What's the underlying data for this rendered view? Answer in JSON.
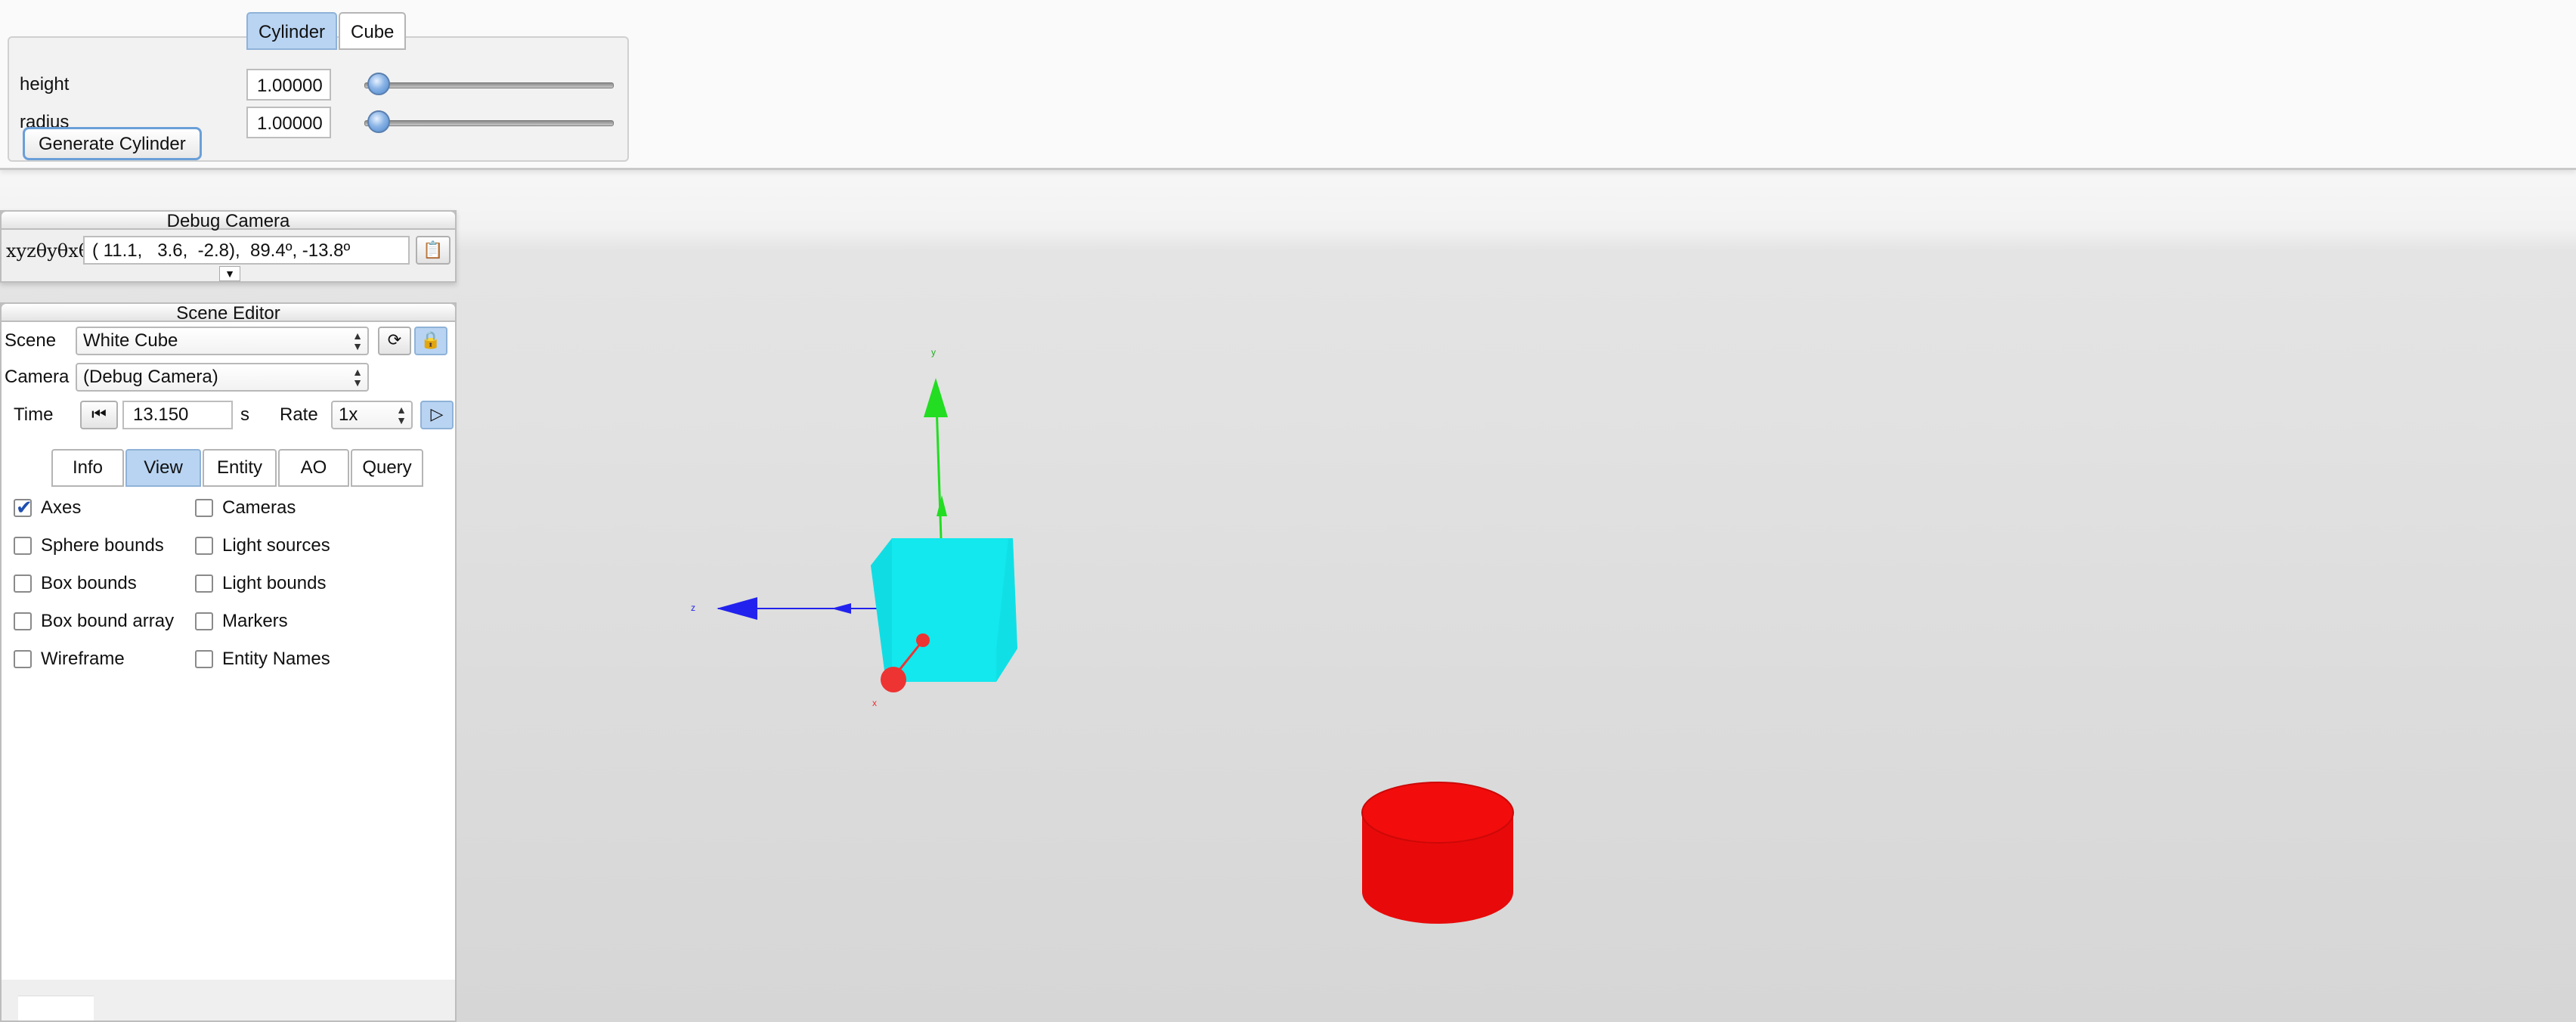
{
  "generator": {
    "tabs": [
      {
        "label": "Cylinder",
        "active": true
      },
      {
        "label": "Cube",
        "active": false
      }
    ],
    "rows": [
      {
        "label": "height",
        "value": "1.00000",
        "slider_fraction": 0.04
      },
      {
        "label": "radius",
        "value": "1.00000",
        "slider_fraction": 0.04
      }
    ],
    "button_label": "Generate Cylinder"
  },
  "debug_camera": {
    "title": "Debug Camera",
    "coord_label": "xyzθyθxθz",
    "coord_value": "( 11.1,   3.6,  -2.8),  89.4º, -13.8º",
    "copy_icon": "copy-icon",
    "expand_icon": "expand-down-icon"
  },
  "scene_editor": {
    "title": "Scene Editor",
    "scene_label": "Scene",
    "scene_value": "White Cube",
    "camera_label": "Camera",
    "camera_value": "(Debug Camera)",
    "reload_icon": "reload-icon",
    "lock_icon": "lock-icon",
    "time_label": "Time",
    "time_value": "13.150",
    "time_unit": "s",
    "rate_label": "Rate",
    "rate_value": "1x",
    "rewind_icon": "rewind-icon",
    "play_icon": "play-icon",
    "tabs": [
      {
        "label": "Info",
        "active": false
      },
      {
        "label": "View",
        "active": true
      },
      {
        "label": "Entity",
        "active": false
      },
      {
        "label": "AO",
        "active": false
      },
      {
        "label": "Query",
        "active": false
      }
    ],
    "view_options_left": [
      {
        "label": "Axes",
        "checked": true
      },
      {
        "label": "Sphere bounds",
        "checked": false
      },
      {
        "label": "Box bounds",
        "checked": false
      },
      {
        "label": "Box bound array",
        "checked": false
      },
      {
        "label": "Wireframe",
        "checked": false
      }
    ],
    "view_options_right": [
      {
        "label": "Cameras",
        "checked": false
      },
      {
        "label": "Light sources",
        "checked": false
      },
      {
        "label": "Light bounds",
        "checked": false
      },
      {
        "label": "Markers",
        "checked": false
      },
      {
        "label": "Entity Names",
        "checked": false
      }
    ]
  },
  "viewport": {
    "axis_labels": {
      "x": "x",
      "y": "y",
      "z": "z"
    },
    "colors": {
      "cube": "#12e8ee",
      "cylinder": "#ee0b0b",
      "x_axis": "#ee3333",
      "y_axis": "#22dd22",
      "z_axis": "#2222ee"
    }
  }
}
